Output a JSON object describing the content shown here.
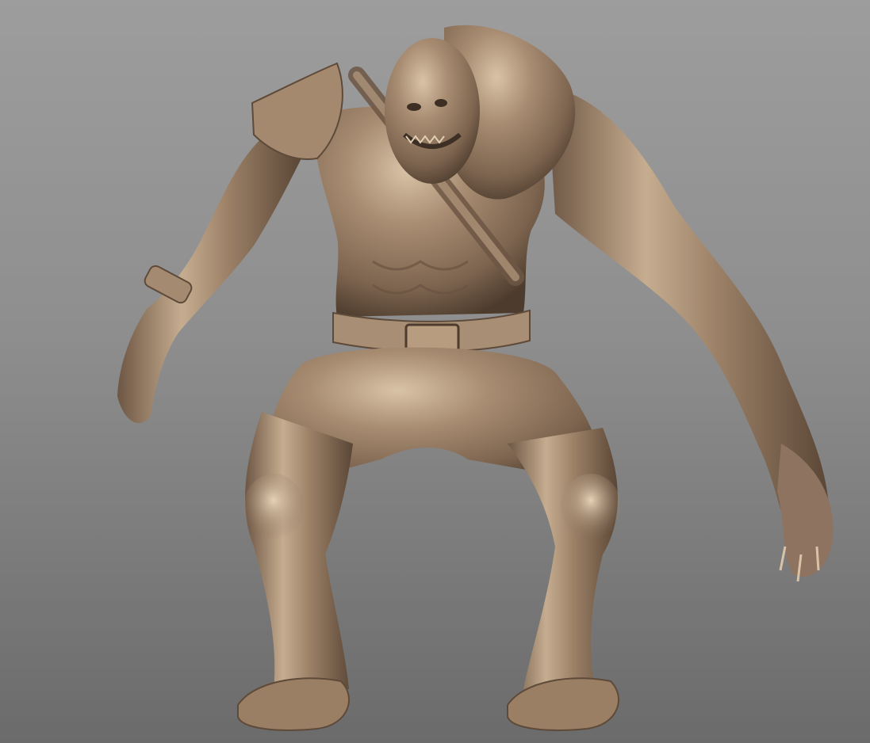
{
  "scene": {
    "subject": "sculpted-creature",
    "background_top": "#9d9d9d",
    "background_bottom": "#6b6b6b",
    "material_base": "#9a7f65",
    "material_highlight": "#d9c3a6",
    "material_shadow": "#4d3c2d"
  }
}
